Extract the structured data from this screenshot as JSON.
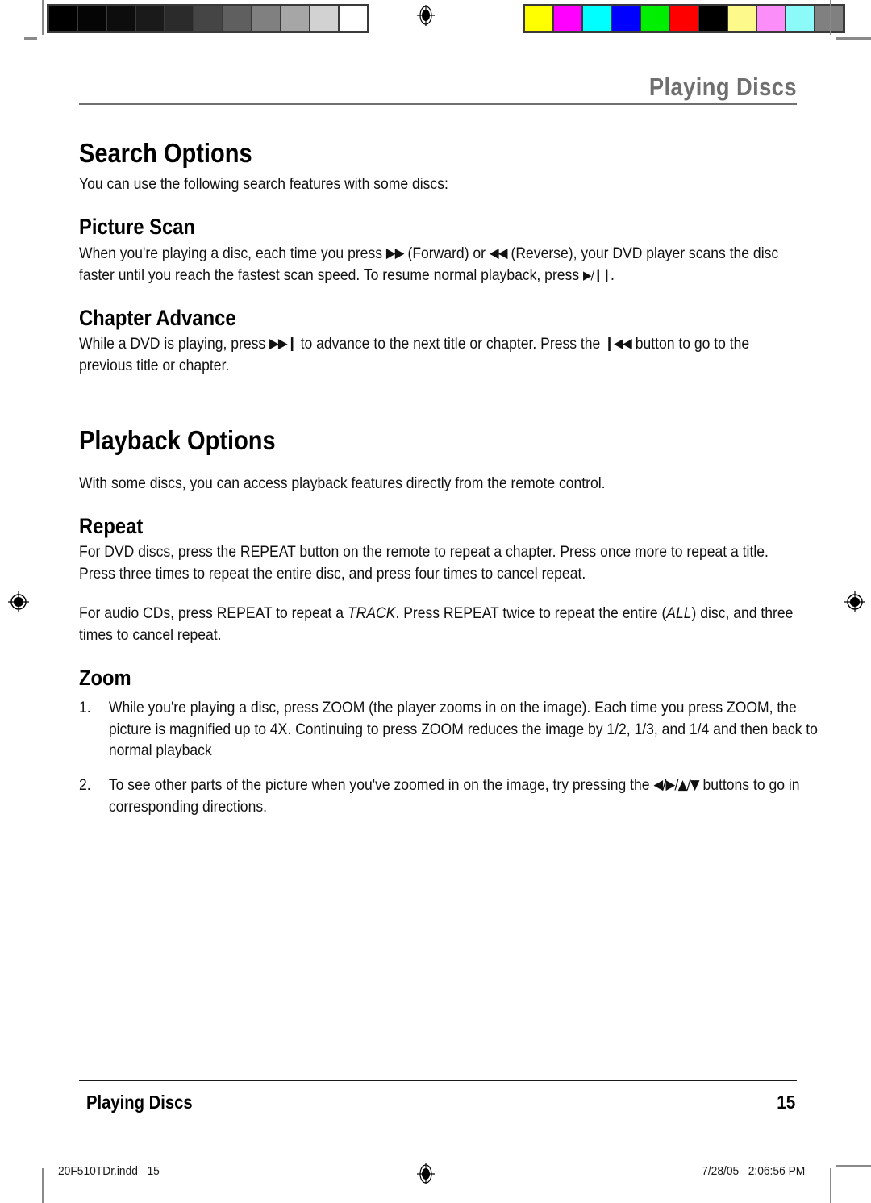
{
  "prepress": {
    "gray_strip_name": "grayscale-calibration-strip",
    "gray_patches": [
      "#000000",
      "#050505",
      "#0d0d0d",
      "#1a1a1a",
      "#2b2b2b",
      "#454545",
      "#5f5f5f",
      "#808080",
      "#a6a6a6",
      "#d2d2d2",
      "#ffffff"
    ],
    "color_strip_name": "color-calibration-strip",
    "color_patches": [
      "#ffff00",
      "#ff00ff",
      "#00ffff",
      "#0000ff",
      "#00ee00",
      "#ff0000",
      "#000000",
      "#fdf98a",
      "#fb8ef9",
      "#8bfaf9",
      "#808080"
    ],
    "registration_mark_name": "registration-target"
  },
  "header": {
    "running_head": "Playing Discs"
  },
  "sections": {
    "search_options": {
      "title": "Search Options",
      "intro": "You can use the following search features with some discs:"
    },
    "picture_scan": {
      "title": "Picture Scan",
      "text_1": "When you're playing a disc, each time you press ",
      "glyph_forward": "▶▶",
      "text_2": " (Forward) or ",
      "glyph_reverse": "◀◀",
      "text_3": " (Reverse), your DVD player scans the disc faster until you reach the fastest scan speed. To resume normal playback, press ",
      "glyph_play_pause": "▶/❙❙",
      "text_4": "."
    },
    "chapter_advance": {
      "title": "Chapter Advance",
      "text_1": "While a DVD is playing, press ",
      "glyph_next": "▶▶❙",
      "text_2": " to advance to the next title or chapter. Press the ",
      "glyph_previous": "❙◀◀",
      "text_3": " button to go to the previous title or chapter."
    },
    "playback_options": {
      "title": "Playback Options",
      "intro": "With some discs, you can access playback features directly from the remote control."
    },
    "repeat": {
      "title": "Repeat",
      "paragraph_1": "For DVD discs, press the REPEAT button on the remote to repeat a chapter. Press once more to repeat a title. Press three times to repeat the entire disc, and press four times to cancel repeat.",
      "paragraph_2_a": "For audio CDs, press REPEAT to repeat a ",
      "paragraph_2_em1": "TRACK",
      "paragraph_2_b": ". Press REPEAT twice to repeat the entire (",
      "paragraph_2_em2": "ALL",
      "paragraph_2_c": ") disc, and three times to cancel repeat."
    },
    "zoom": {
      "title": "Zoom",
      "steps": [
        {
          "number": "1.",
          "text": "While you're playing a disc, press ZOOM (the player zooms in on the image). Each time you press ZOOM, the picture is magnified up to 4X. Continuing to press ZOOM reduces the image by 1/2, 1/3, and 1/4 and then back to normal playback"
        },
        {
          "number": "2.",
          "text_1": "To see other parts of the picture when you've zoomed in on the image, try pressing the ",
          "glyph_directions": "◀/▶/▲/▼",
          "text_2": " buttons to go in corresponding directions."
        }
      ]
    }
  },
  "footer": {
    "section_name": "Playing Discs",
    "page_number": "15"
  },
  "slug": {
    "file_name": "20F510TDr.indd",
    "file_page": "15",
    "date": "7/28/05",
    "time": "2:06:56 PM"
  }
}
